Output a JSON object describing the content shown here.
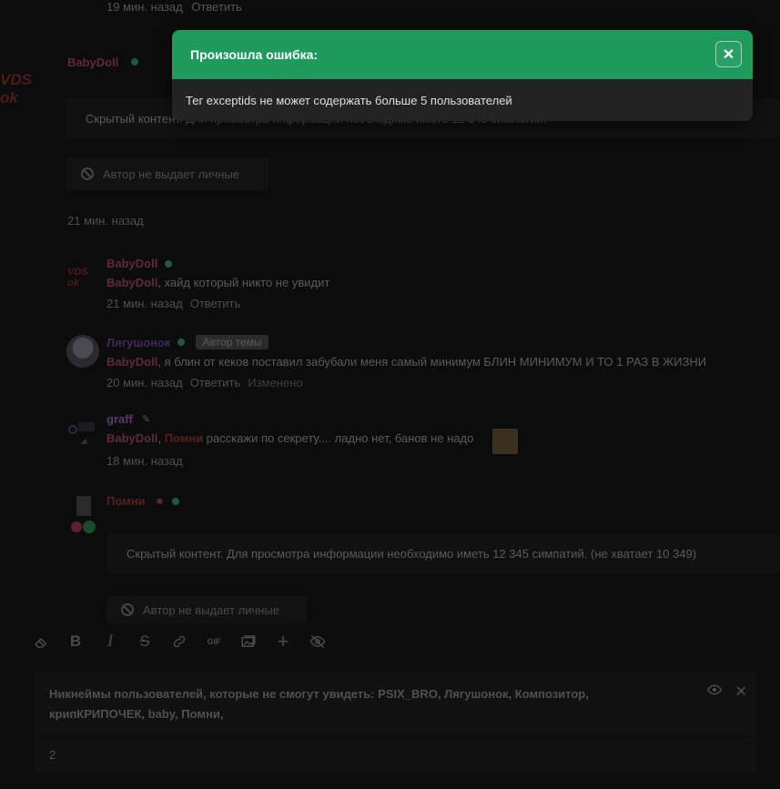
{
  "toast": {
    "title": "Произошла ошибка:",
    "message": "Тег exceptids не может содержать больше 5 пользователей",
    "close_glyph": "✕",
    "header_color": "#1f9a5d"
  },
  "thread": {
    "top_meta": {
      "time": "19 мин. назад",
      "reply": "Ответить"
    },
    "post1": {
      "avatar_text": "VDS ok",
      "username": "BabyDoll",
      "hidden_text": "Скрытый контент. Для просмотра информации необходимо иметь 12 345 симпатий.",
      "no_likes_label": "Автор не выдает личные",
      "time": "21 мин. назад"
    },
    "replies": [
      {
        "avatar_text": "VDS ok",
        "username": "BabyDoll",
        "quote_user": "BabyDoll",
        "text": ", хайд который никто не увидит",
        "time": "21 мин. назад",
        "action": "Ответить",
        "extra": ""
      },
      {
        "username": "Лягушонок",
        "badge": "Автор темы",
        "quote_user": "BabyDoll",
        "text": ", я блин от кеков поставил забубали меня самый минимум БЛИН МИНИМУМ И ТО 1 РАЗ В ЖИЗНИ",
        "time": "20 мин. назад",
        "action": "Ответить",
        "extra": "Изменено"
      },
      {
        "username": "graff",
        "quote_user": "BabyDoll",
        "quote_user2": "Помни",
        "text": " расскажи по секрету.... ладно нет, банов не надо",
        "time": "18 мин. назад",
        "action": "",
        "extra": ""
      },
      {
        "username": "Помни",
        "hidden_text": "Скрытый контент. Для просмотра информации необходимо иметь 12 345 симпатий. (не хватает 10 349)",
        "no_likes_label": "Автор не выдает личные"
      }
    ]
  },
  "editor": {
    "hide_panel_title": "Никнеймы пользователей, которые не смогут увидеть: PSIX_BRO, Лягушонок, Композитор, крипКРИПОЧЕК, baby, Помни,",
    "body_text": "2",
    "toolbar_icons": [
      "eraser-icon",
      "bold-icon",
      "italic-icon",
      "strikethrough-icon",
      "link-icon",
      "gif-icon",
      "image-icon",
      "plus-icon",
      "hide-icon"
    ],
    "toolbar_labels": {
      "bold": "B",
      "italic": "I",
      "strike": "S",
      "gif": "GIF",
      "plus": "+"
    }
  }
}
